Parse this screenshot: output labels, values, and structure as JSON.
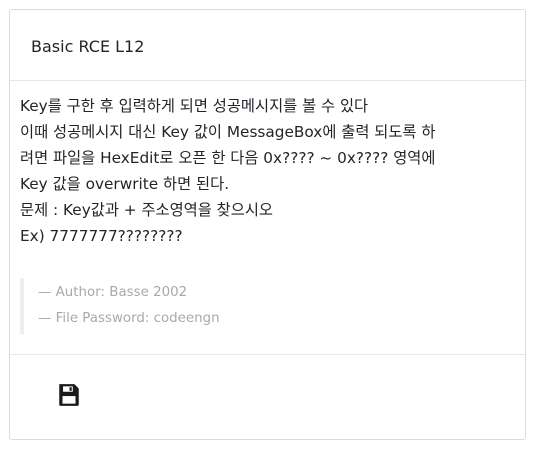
{
  "card": {
    "title": "Basic RCE L12",
    "description": [
      "Key를 구한 후 입력하게 되면 성공메시지를 볼 수 있다",
      "이때 성공메시지 대신 Key 값이 MessageBox에 출력 되도록 하",
      "려면 파일을 HexEdit로 오픈 한 다음 0x???? ~ 0x???? 영역에",
      "Key 값을 overwrite 하면 된다.",
      "문제 : Key값과 + 주소영역을 찾으시오",
      "Ex) 7777777????????"
    ],
    "meta": {
      "author": "— Author: Basse 2002",
      "password": "— File Password: codeengn"
    }
  },
  "footer": {
    "save_icon": "floppy-disk-icon"
  }
}
